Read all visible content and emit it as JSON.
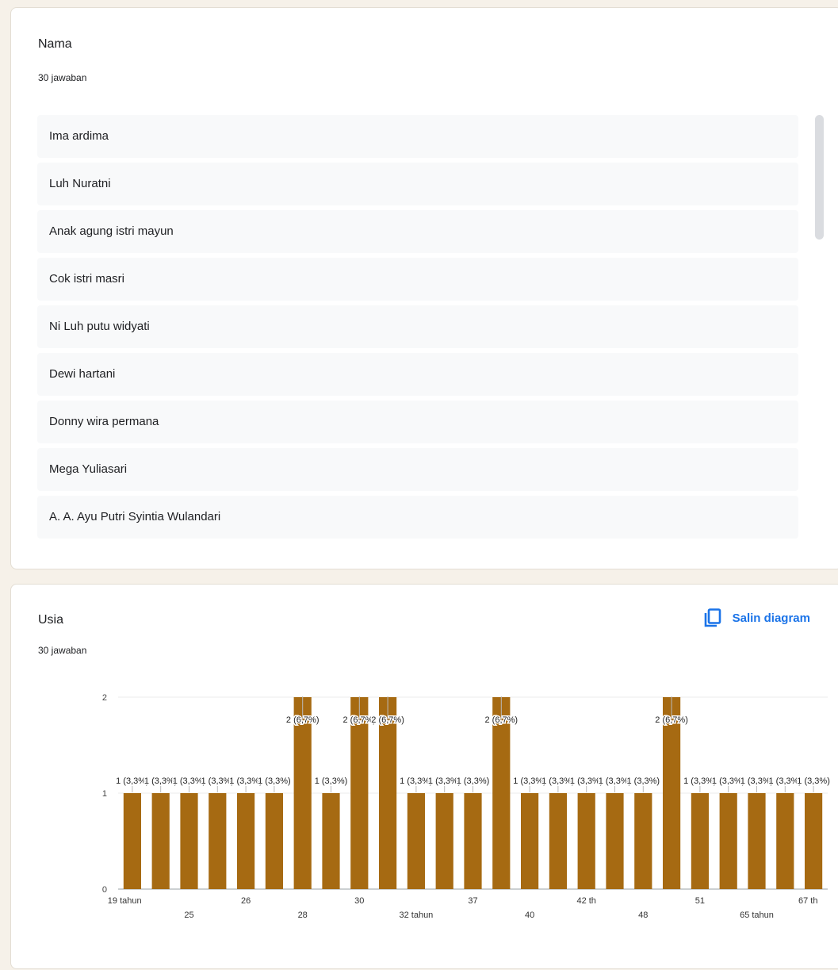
{
  "questions": {
    "nama": {
      "title": "Nama",
      "count": "30 jawaban",
      "responses": [
        "Ima ardima",
        "Luh Nuratni",
        "Anak agung istri mayun",
        "Cok istri masri",
        "Ni Luh putu widyati",
        "Dewi hartani",
        "Donny wira permana",
        "Mega Yuliasari",
        "A. A. Ayu Putri Syintia Wulandari"
      ]
    },
    "usia": {
      "title": "Usia",
      "count": "30 jawaban",
      "copy_label": "Salin diagram",
      "copy_icon": "copy-icon"
    }
  },
  "colors": {
    "bar": "#a66a12",
    "accent": "#1a73e8",
    "item_bg": "#f8f9fa"
  },
  "chart_data": {
    "type": "bar",
    "ylim": [
      0,
      2
    ],
    "yticks": [
      "0",
      "1",
      "2"
    ],
    "x_tick_labels": [
      "19 tahun",
      "25",
      "26",
      "28",
      "30",
      "32 tahun",
      "37",
      "40",
      "42 th",
      "48",
      "51",
      "65 tahun",
      "67 th"
    ],
    "values": [
      1,
      1,
      1,
      1,
      1,
      1,
      2,
      1,
      2,
      2,
      1,
      1,
      1,
      2,
      1,
      1,
      1,
      1,
      1,
      2,
      1,
      1,
      1,
      1,
      1
    ],
    "data_labels": [
      "1 (3,3%)",
      "1 (3,3%)",
      "1 (3,3%)",
      "1 (3,3%)",
      "1 (3,3%)",
      "1 (3,3%)",
      "2 (6,7%)",
      "1 (3,3%)",
      "2 (6,7%)",
      "2 (6,7%)",
      "1 (3,3%)",
      "1 (3,3%)",
      "1 (3,3%)",
      "2 (6,7%)",
      "1 (3,3%)",
      "1 (3,3%)",
      "1 (3,3%)",
      "1 (3,3%)",
      "1 (3,3%)",
      "2 (6,7%)",
      "1 (3,3%)",
      "1 (3,3%)",
      "1 (3,3%)",
      "1 (3,3%)",
      "1 (3,3%)"
    ]
  }
}
